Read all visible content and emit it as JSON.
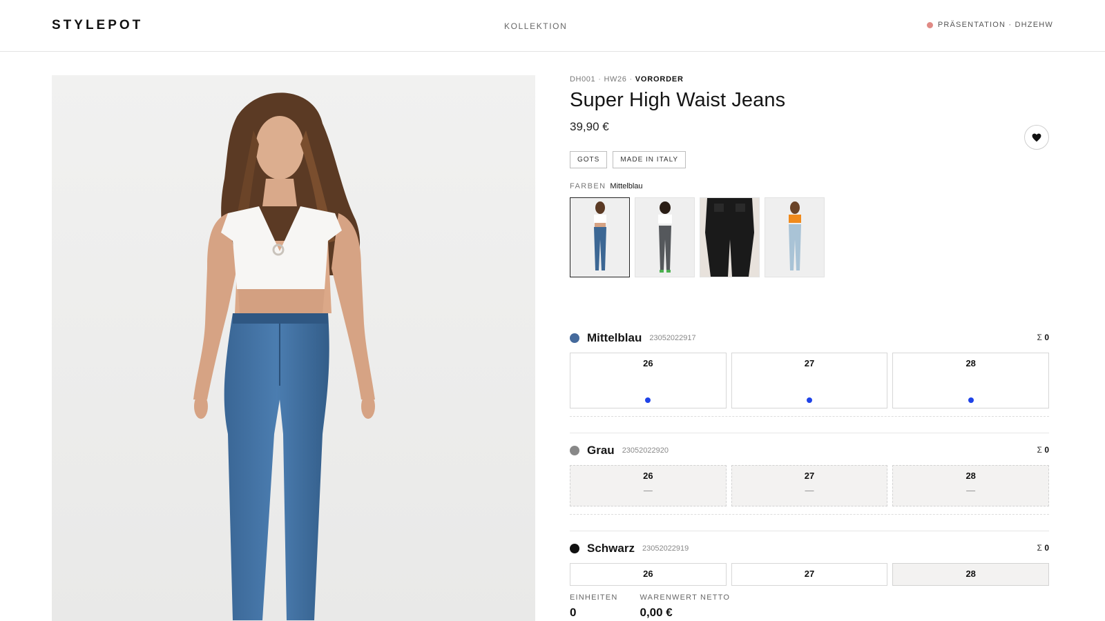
{
  "header": {
    "logo": "STYLEPOT",
    "nav": "KOLLEKTION",
    "session": "PRÄSENTATION · DHZEHW",
    "status_color": "#e08a85"
  },
  "product": {
    "sku": "DH001",
    "season": "HW26",
    "status": "VORORDER",
    "title": "Super High Waist Jeans",
    "price": "39,90 €",
    "tags": [
      "GOTS",
      "MADE IN ITALY"
    ],
    "favorite_icon": "heart-icon"
  },
  "colors": {
    "label": "FARBEN",
    "selected": "Mittelblau",
    "thumbnails": [
      {
        "name": "Mittelblau",
        "top_color": "#ffffff",
        "jeans_color": "#3c6794",
        "active": true
      },
      {
        "name": "Grau",
        "top_color": "#ffffff",
        "jeans_color": "#55585c",
        "active": false
      },
      {
        "name": "Schwarz",
        "top_color": "#1a1a1a",
        "jeans_color": "#1a1a1a",
        "active": false
      },
      {
        "name": "Hellblau",
        "top_color": "#f08a1c",
        "jeans_color": "#a9c3d6",
        "active": false
      }
    ]
  },
  "variants": [
    {
      "name": "Mittelblau",
      "code": "23052022917",
      "swatch": "#456a9c",
      "sum_symbol": "Σ",
      "sum": "0",
      "sizes": [
        {
          "label": "26",
          "available": true
        },
        {
          "label": "27",
          "available": true
        },
        {
          "label": "28",
          "available": true
        }
      ]
    },
    {
      "name": "Grau",
      "code": "23052022920",
      "swatch": "#888888",
      "sum_symbol": "Σ",
      "sum": "0",
      "sizes": [
        {
          "label": "26",
          "available": false,
          "mark": "—"
        },
        {
          "label": "27",
          "available": false,
          "mark": "—"
        },
        {
          "label": "28",
          "available": false,
          "mark": "—"
        }
      ]
    },
    {
      "name": "Schwarz",
      "code": "23052022919",
      "swatch": "#111111",
      "sum_symbol": "Σ",
      "sum": "0",
      "sizes": [
        {
          "label": "26",
          "available": true
        },
        {
          "label": "27",
          "available": true
        },
        {
          "label": "28",
          "available": false
        }
      ]
    }
  ],
  "totals": {
    "units_label": "EINHEITEN",
    "units_value": "0",
    "value_label": "WARENWERT NETTO",
    "value_value": "0,00 €"
  },
  "accent_dot_color": "#1f43e8"
}
